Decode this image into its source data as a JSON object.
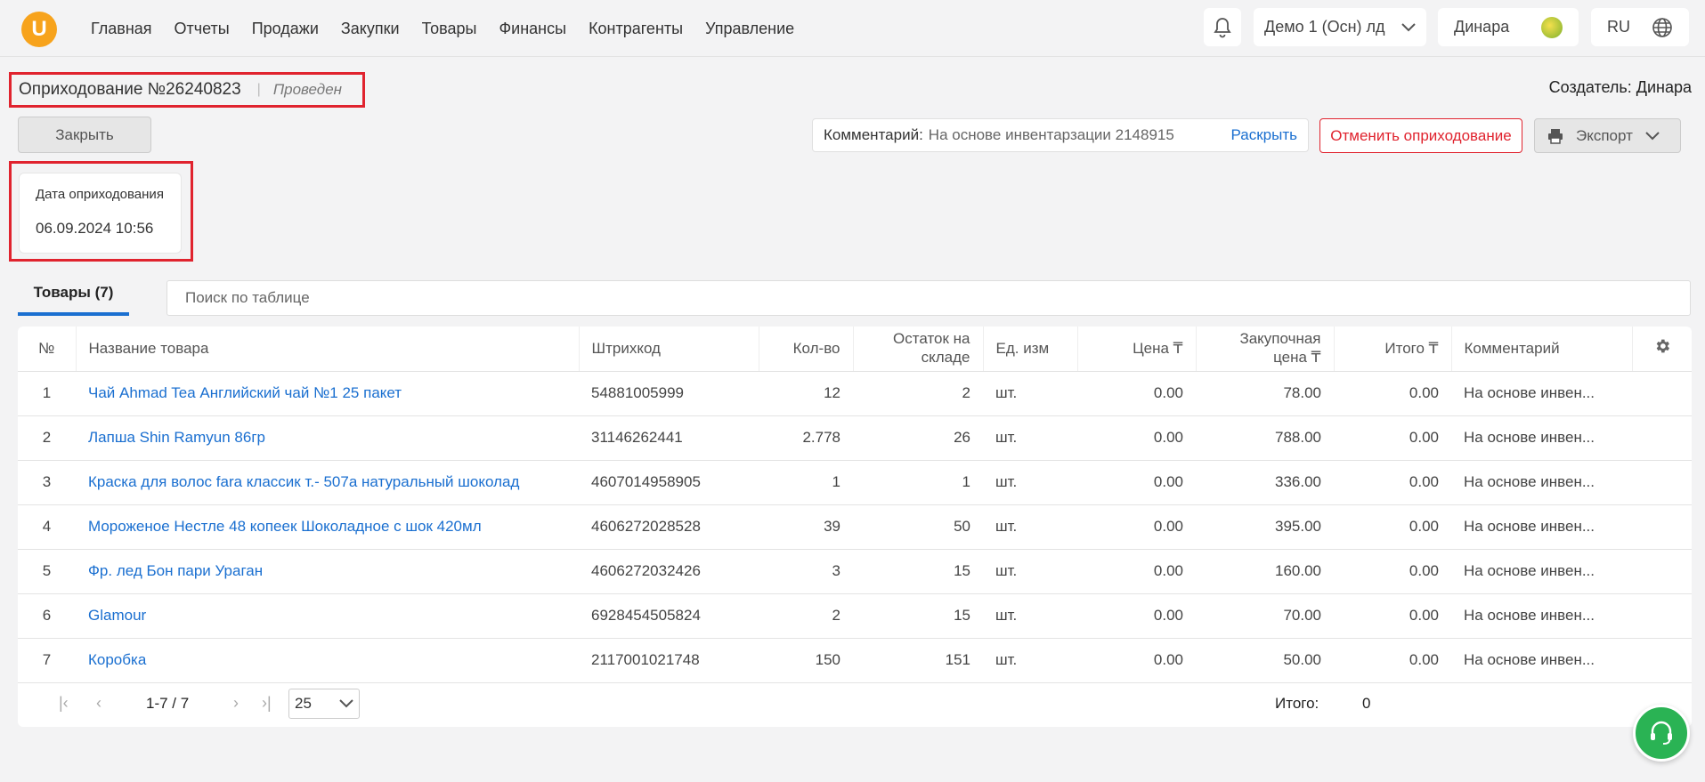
{
  "nav": {
    "logo_letter": "U",
    "items": [
      "Главная",
      "Отчеты",
      "Продажи",
      "Закупки",
      "Товары",
      "Финансы",
      "Контрагенты",
      "Управление"
    ],
    "store": "Демо 1 (Осн) лд",
    "user": "Динара",
    "lang": "RU"
  },
  "doc": {
    "title": "Оприходование №26240823",
    "status": "Проведен",
    "creator": "Создатель: Динара",
    "close_label": "Закрыть",
    "comment_label": "Комментарий:",
    "comment_text": "На основе инвентарзации 2148915",
    "expand_label": "Раскрыть",
    "cancel_label": "Отменить оприходование",
    "export_label": "Экспорт",
    "date_label": "Дата оприходования",
    "date_value": "06.09.2024 10:56"
  },
  "tabs": {
    "goods_label": "Товары",
    "goods_count": "(7)"
  },
  "search": {
    "placeholder": "Поиск по таблице"
  },
  "table": {
    "headers": {
      "num": "№",
      "name": "Название товара",
      "barcode": "Штрихкод",
      "qty": "Кол-во",
      "stock_1": "Остаток на",
      "stock_2": "складе",
      "unit": "Ед. изм",
      "price": "Цена ₸",
      "purchase_1": "Закупочная",
      "purchase_2": "цена ₸",
      "total": "Итого ₸",
      "comment": "Комментарий"
    },
    "rows": [
      {
        "num": "1",
        "name": "Чай Ahmad Tea Английский чай №1 25 пакет",
        "barcode": "54881005999",
        "qty": "12",
        "stock": "2",
        "unit": "шт.",
        "price": "0.00",
        "purchase": "78.00",
        "total": "0.00",
        "comment": "На основе инвен..."
      },
      {
        "num": "2",
        "name": "Лапша Shin Ramyun 86гр",
        "barcode": "31146262441",
        "qty": "2.778",
        "stock": "26",
        "unit": "шт.",
        "price": "0.00",
        "purchase": "788.00",
        "total": "0.00",
        "comment": "На основе инвен..."
      },
      {
        "num": "3",
        "name": "Краска для волос fara классик т.- 507а натуральный шоколад",
        "barcode": "4607014958905",
        "qty": "1",
        "stock": "1",
        "unit": "шт.",
        "price": "0.00",
        "purchase": "336.00",
        "total": "0.00",
        "comment": "На основе инвен..."
      },
      {
        "num": "4",
        "name": "Мороженое Нестле 48 копеек Шоколадное с шок 420мл",
        "barcode": "4606272028528",
        "qty": "39",
        "stock": "50",
        "unit": "шт.",
        "price": "0.00",
        "purchase": "395.00",
        "total": "0.00",
        "comment": "На основе инвен..."
      },
      {
        "num": "5",
        "name": "Фр. лед Бон пари Ураган",
        "barcode": "4606272032426",
        "qty": "3",
        "stock": "15",
        "unit": "шт.",
        "price": "0.00",
        "purchase": "160.00",
        "total": "0.00",
        "comment": "На основе инвен..."
      },
      {
        "num": "6",
        "name": "Glamour",
        "barcode": "6928454505824",
        "qty": "2",
        "stock": "15",
        "unit": "шт.",
        "price": "0.00",
        "purchase": "70.00",
        "total": "0.00",
        "comment": "На основе инвен..."
      },
      {
        "num": "7",
        "name": "Коробка",
        "barcode": "2117001021748",
        "qty": "150",
        "stock": "151",
        "unit": "шт.",
        "price": "0.00",
        "purchase": "50.00",
        "total": "0.00",
        "comment": "На основе инвен..."
      }
    ]
  },
  "pager": {
    "info": "1-7 / 7",
    "page_size": "25",
    "total_label": "Итого:",
    "total_value": "0"
  },
  "colors": {
    "accent": "#1a6fd0",
    "danger": "#e0232e",
    "logo": "#f7a31c",
    "support": "#2ab354"
  }
}
